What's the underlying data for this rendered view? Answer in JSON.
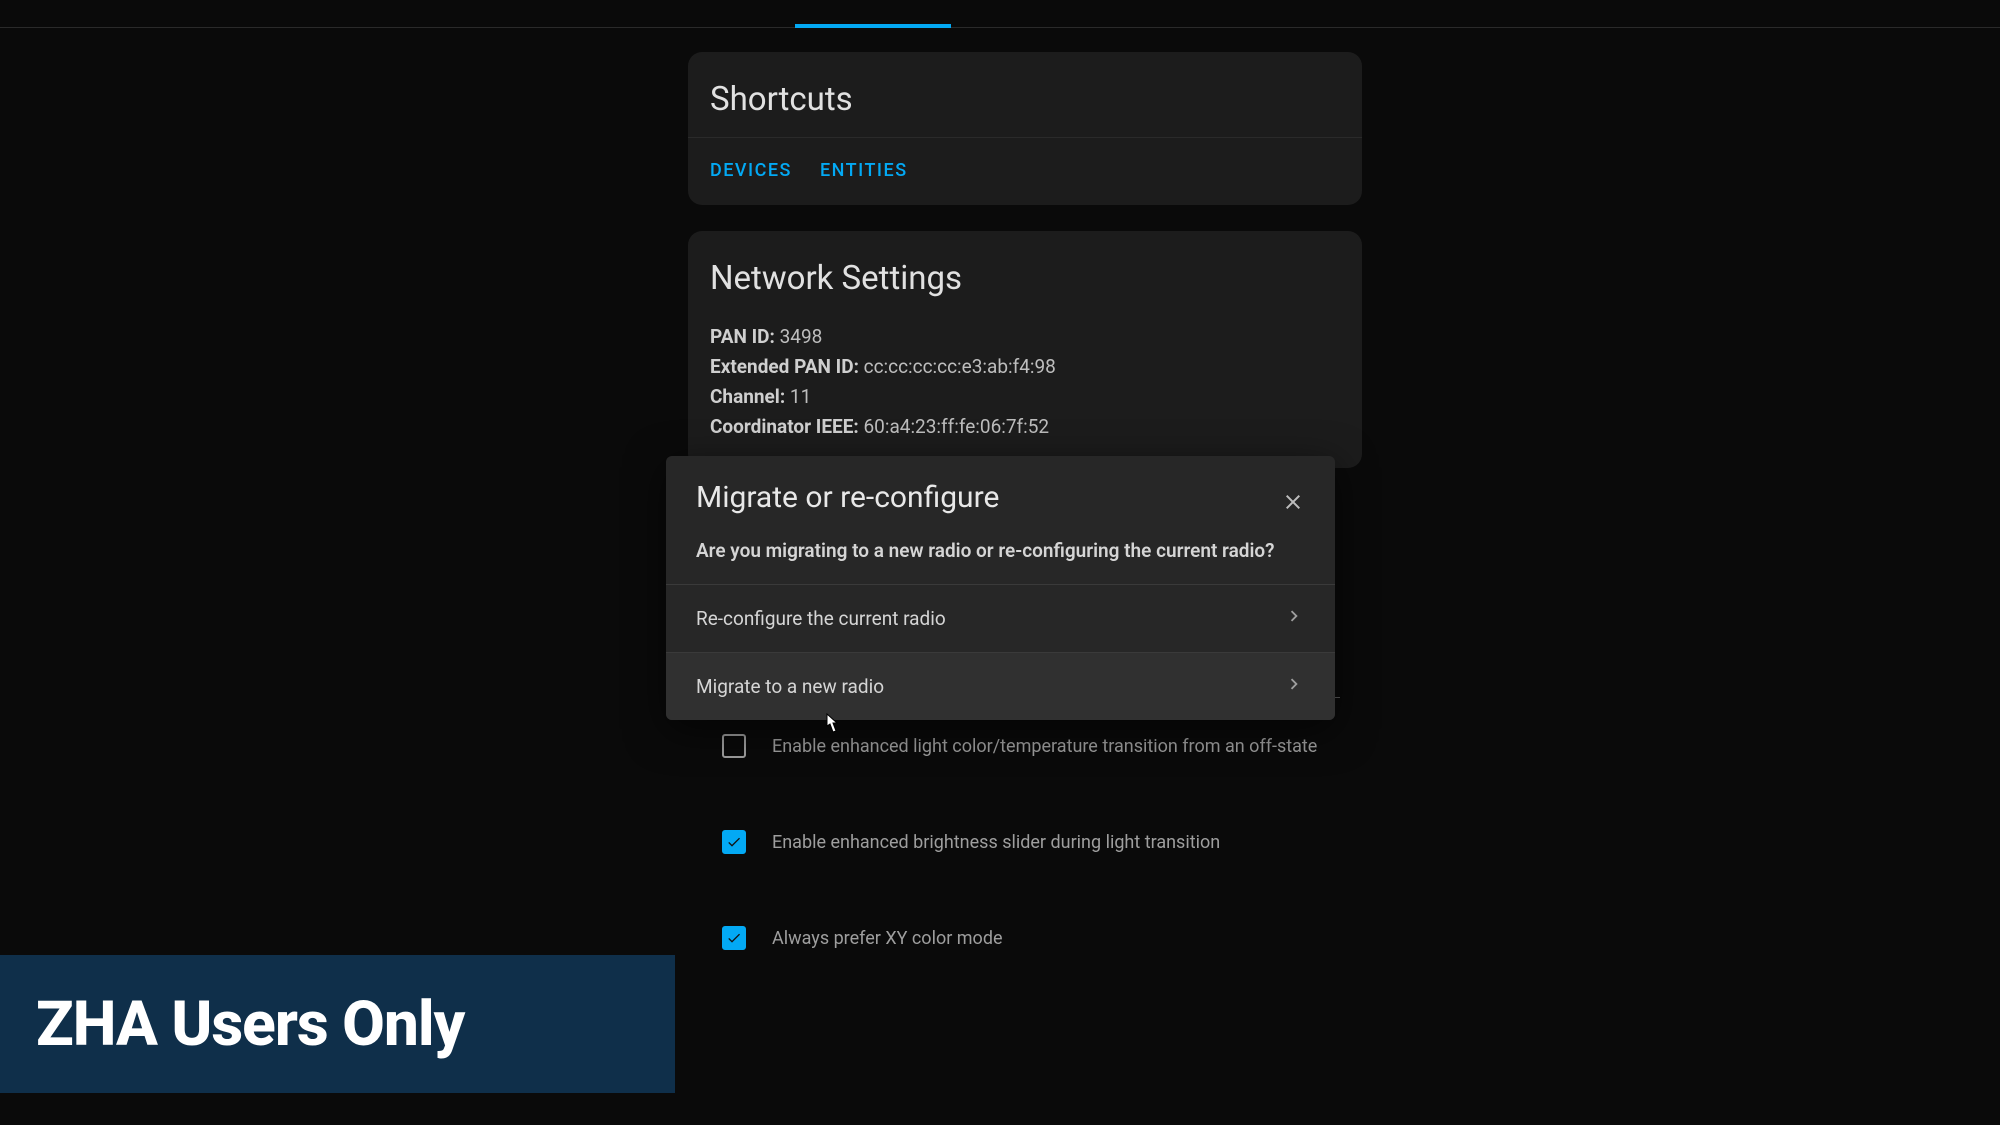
{
  "shortcuts": {
    "title": "Shortcuts",
    "devices": "DEVICES",
    "entities": "ENTITIES"
  },
  "network": {
    "title": "Network Settings",
    "pan_id_label": "PAN ID:",
    "pan_id_value": "3498",
    "ext_pan_label": "Extended PAN ID:",
    "ext_pan_value": "cc:cc:cc:cc:e3:ab:f4:98",
    "channel_label": "Channel:",
    "channel_value": "11",
    "coord_label": "Coordinator IEEE:",
    "coord_value": "60:a4:23:ff:fe:06:7f:52"
  },
  "options": {
    "input_value": "0",
    "enhanced_color": {
      "checked": false,
      "label": "Enable enhanced light color/temperature transition from an off-state"
    },
    "enhanced_brightness": {
      "checked": true,
      "label": "Enable enhanced brightness slider during light transition"
    },
    "xy_color": {
      "checked": true,
      "label": "Always prefer XY color mode"
    }
  },
  "dialog": {
    "title": "Migrate or re-configure",
    "subtitle": "Are you migrating to a new radio or re-configuring the current radio?",
    "reconfigure": "Re-configure the current radio",
    "migrate": "Migrate to a new radio"
  },
  "banner": {
    "text": "ZHA Users Only"
  }
}
